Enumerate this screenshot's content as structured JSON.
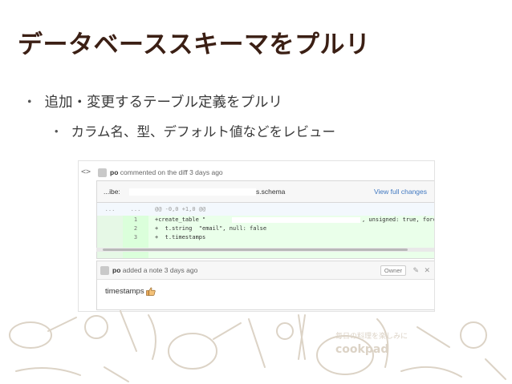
{
  "slide": {
    "title": "データベーススキーマをプルリ",
    "bullet1": "追加・変更するテーブル定義をプルリ",
    "bullet2": "カラム名、型、デフォルト値などをレビュー",
    "bullet_dot": "・"
  },
  "comment": {
    "username": "po",
    "action": "commented on the diff 3 days ago"
  },
  "diff": {
    "path_prefix": "...ibe:",
    "path_suffix": "s.schema",
    "view_full": "View full changes",
    "hunk_ln1": "...",
    "hunk_ln2": "...",
    "hunk_header": "@@ -0,0 +1,0 @@",
    "lines": [
      {
        "num": "1",
        "code": "+create_table \"",
        "tail": ", unsigned: true, force: :c"
      },
      {
        "num": "2",
        "code": "+  t.string  \"email\", null: false"
      },
      {
        "num": "3",
        "code": "+  t.timestamps"
      }
    ]
  },
  "note": {
    "username": "po",
    "action": "added a note 3 days ago",
    "owner_label": "Owner",
    "body": "timestamps"
  },
  "doodle_text": {
    "tagline": "毎日の料理を楽しみに",
    "brand": "cookpad"
  }
}
